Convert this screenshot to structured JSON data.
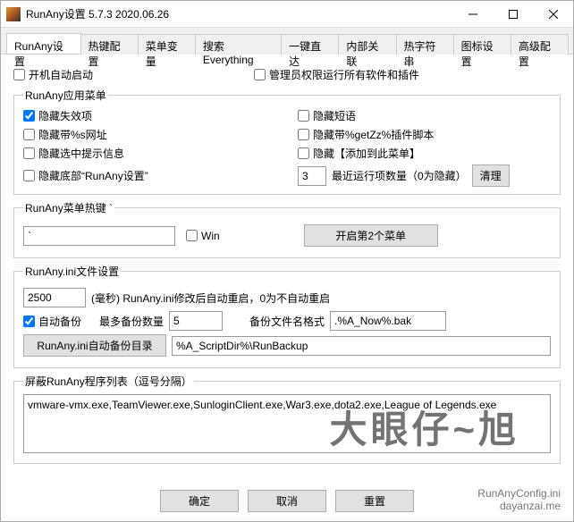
{
  "titlebar": {
    "title": "RunAny设置 5.7.3 2020.06.26"
  },
  "tabs": [
    {
      "label": "RunAny设置",
      "active": true
    },
    {
      "label": "热键配置"
    },
    {
      "label": "菜单变量"
    },
    {
      "label": "搜索Everything"
    },
    {
      "label": "一键直达"
    },
    {
      "label": "内部关联"
    },
    {
      "label": "热字符串"
    },
    {
      "label": "图标设置"
    },
    {
      "label": "高级配置"
    }
  ],
  "top": {
    "autostart": "开机自动启动",
    "admin": "管理员权限运行所有软件和插件"
  },
  "menuGroup": {
    "legend": "RunAny应用菜单",
    "left": [
      "隐藏失效项",
      "隐藏带%s网址",
      "隐藏选中提示信息",
      "隐藏底部“RunAny设置”"
    ],
    "right": [
      "隐藏短语",
      "隐藏带%getZz%插件脚本",
      "隐藏【添加到此菜单】"
    ],
    "recentCount": "3",
    "recentLabel": "最近运行项数量（0为隐藏）",
    "cleanBtn": "清理"
  },
  "hotkeyGroup": {
    "legend": "RunAny菜单热键 `",
    "value": "`",
    "win": "Win",
    "open2": "开启第2个菜单"
  },
  "iniGroup": {
    "legend": "RunAny.ini文件设置",
    "delay": "2500",
    "delayLabel": "(毫秒)  RunAny.ini修改后自动重启，0为不自动重启",
    "autoBackup": "自动备份",
    "maxBackupLabel": "最多备份数量",
    "maxBackup": "5",
    "formatLabel": "备份文件名格式",
    "format": ".%A_Now%.bak",
    "dirBtn": "RunAny.ini自动备份目录",
    "dir": "%A_ScriptDir%\\RunBackup"
  },
  "blockGroup": {
    "legend": "屏蔽RunAny程序列表（逗号分隔）",
    "value": "vmware-vmx.exe,TeamViewer.exe,SunloginClient.exe,War3.exe,dota2.exe,League of Legends.exe"
  },
  "buttons": {
    "ok": "确定",
    "cancel": "取消",
    "reset": "重置"
  },
  "footer": {
    "line1": "RunAnyConfig.ini",
    "line2": "dayanzai.me"
  },
  "watermark": "大眼仔~旭"
}
